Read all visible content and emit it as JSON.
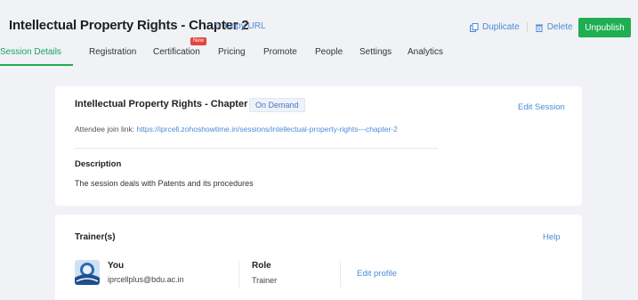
{
  "header": {
    "title": "Intellectual Property Rights - Chapter 2",
    "copy_url": "Copy URL",
    "duplicate": "Duplicate",
    "delete": "Delete",
    "unpublish": "Unpublish"
  },
  "tabs": [
    {
      "label": "Session Details",
      "active": true
    },
    {
      "label": "Registration"
    },
    {
      "label": "Certification",
      "badge": "New"
    },
    {
      "label": "Pricing"
    },
    {
      "label": "Promote"
    },
    {
      "label": "People"
    },
    {
      "label": "Settings"
    },
    {
      "label": "Analytics"
    }
  ],
  "session": {
    "title": "Intellectual Property Rights - Chapter 2",
    "status": "On Demand",
    "edit_label": "Edit Session",
    "join_label": "Attendee join link:",
    "join_url": "https://iprcell.zohoshowtime.in/sessions/intellectual-property-rights---chapter-2",
    "description_label": "Description",
    "description": "The session deals with Patents and its procedures"
  },
  "trainers": {
    "label": "Trainer(s)",
    "help": "Help",
    "trainer": {
      "name": "You",
      "email": "iprcellplus@bdu.ac.in",
      "role_label": "Role",
      "role": "Trainer",
      "edit_profile": "Edit profile"
    }
  },
  "colors": {
    "accent_green": "#1fae52",
    "link_blue": "#4a8bd6",
    "badge_red": "#e8443a",
    "background": "#f0f2f5"
  }
}
